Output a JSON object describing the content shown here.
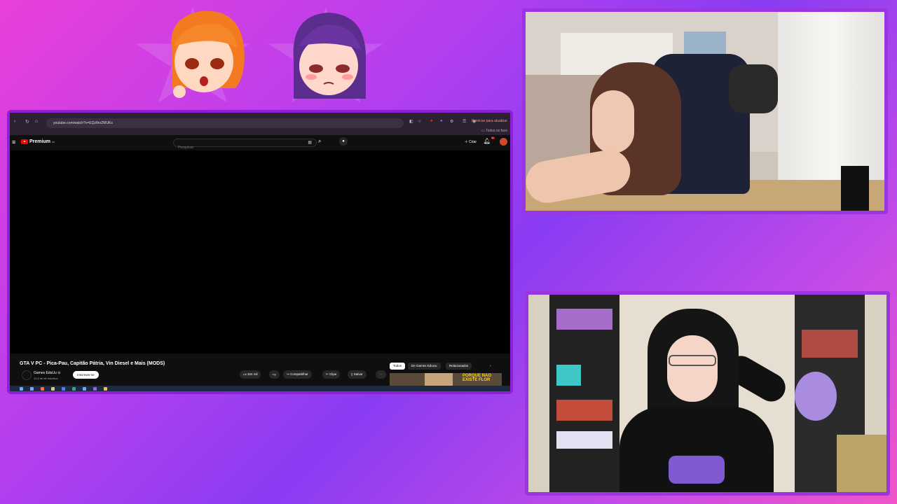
{
  "browser": {
    "url": "youtube.com/watch?v=EQz8nrZMUKs",
    "restart_label": "Reiniciar para atualizar",
    "favorites_label": "Todos os favo"
  },
  "youtube": {
    "logo": "Premium",
    "logo_region": "BR",
    "search_placeholder": "Pesquisar",
    "create_label": "Criar",
    "notification_count": "9+",
    "video_title": "GTA V PC - Pica-Pau, Capitão Pátria, Vin Diesel e Mais (MODS)",
    "channel_name": "Games EduUu",
    "channel_verified": "⊙",
    "subscribers": "12,6 mi de inscritos",
    "subscribe_label": "Inscrever-se",
    "likes": "324 mil",
    "share_label": "Compartilhar",
    "clip_label": "Clipe",
    "save_label": "Salvar",
    "more_label": "···",
    "chips": [
      "Todos",
      "De Games EduUu",
      "Relacionados"
    ],
    "thumb_text": "PORQUE NÃO EXISTE FLOR"
  },
  "icons": {
    "menu": "hamburger-icon",
    "search": "search-icon",
    "mic": "mic-icon",
    "bell": "bell-icon",
    "like": "thumbs-up-icon",
    "dislike": "thumbs-down-icon"
  },
  "colors": {
    "frame": "#9b35e0",
    "yt_red": "#ff0000",
    "bg_pink": "#e93fd9",
    "bg_purple": "#8a3cf2"
  }
}
